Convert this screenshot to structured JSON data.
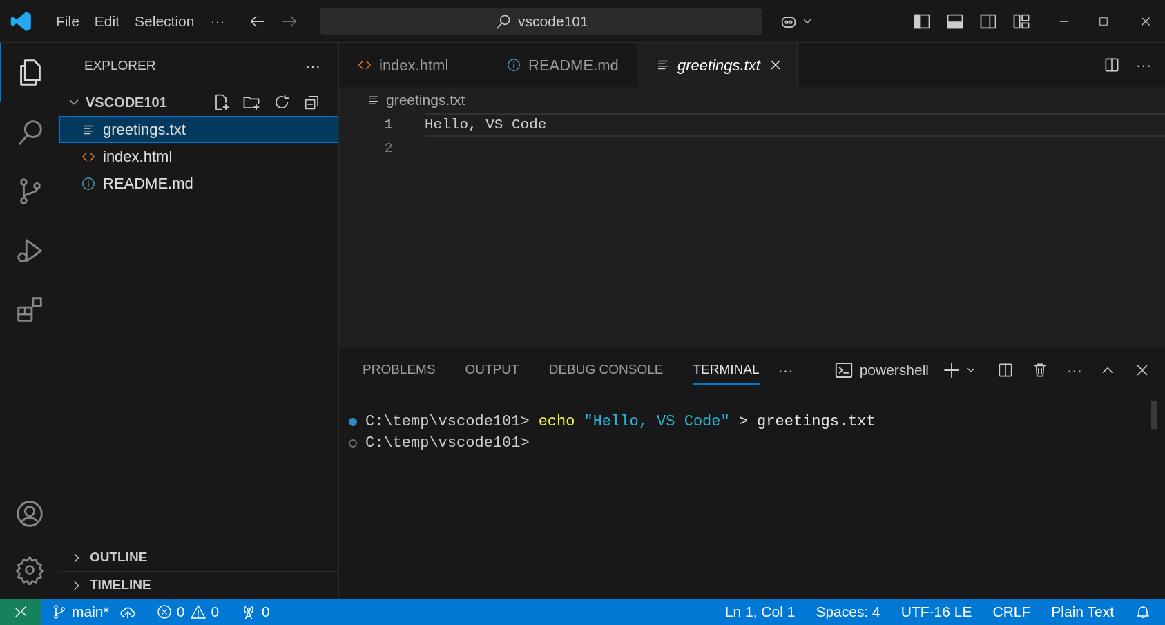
{
  "title_bar": {
    "menus": [
      "File",
      "Edit",
      "Selection"
    ],
    "more": "···",
    "search": "vscode101"
  },
  "activity_bar": {
    "items": [
      {
        "kind": "files",
        "selected": true
      },
      {
        "kind": "search",
        "selected": false
      },
      {
        "kind": "source-control",
        "selected": false
      },
      {
        "kind": "run",
        "selected": false
      },
      {
        "kind": "extensions",
        "selected": false
      }
    ]
  },
  "sidebar": {
    "title": "EXPLORER",
    "more": "···",
    "folder": {
      "name": "VSCODE101",
      "expanded": true
    },
    "files": [
      {
        "name": "greetings.txt",
        "kind": "text",
        "selected": true
      },
      {
        "name": "index.html",
        "kind": "html",
        "selected": false
      },
      {
        "name": "README.md",
        "kind": "info",
        "selected": false
      }
    ],
    "sections": [
      {
        "name": "OUTLINE",
        "expanded": false
      },
      {
        "name": "TIMELINE",
        "expanded": false
      }
    ]
  },
  "tabs": [
    {
      "label": "index.html",
      "kind": "html",
      "selected": false,
      "preview": false
    },
    {
      "label": "README.md",
      "kind": "info",
      "selected": false,
      "preview": false
    },
    {
      "label": "greetings.txt",
      "kind": "text",
      "selected": true,
      "preview": true
    }
  ],
  "editor": {
    "breadcrumb": "greetings.txt",
    "lines": [
      {
        "number": "1",
        "text": "Hello, VS Code",
        "current": true
      },
      {
        "number": "2",
        "current": false
      }
    ]
  },
  "panel": {
    "tabs": [
      {
        "label": "PROBLEMS",
        "selected": false
      },
      {
        "label": "OUTPUT",
        "selected": false
      },
      {
        "label": "DEBUG CONSOLE",
        "selected": false
      },
      {
        "label": "TERMINAL",
        "selected": true
      }
    ],
    "more": "···",
    "shell": "powershell",
    "terminal": [
      {
        "completed": true,
        "segments": [
          {
            "kind": "prompt",
            "text": "C:\\temp\\vscode101>"
          },
          {
            "kind": "command",
            "text": "echo"
          },
          {
            "kind": "string",
            "text": "\"Hello, VS Code\""
          },
          {
            "kind": "plain",
            "text": "> greetings.txt"
          }
        ]
      },
      {
        "completed": false,
        "cursor": true,
        "segments": [
          {
            "kind": "prompt",
            "text": "C:\\temp\\vscode101>"
          }
        ]
      }
    ]
  },
  "status_bar": {
    "branch": "main*",
    "errors": "0",
    "warnings": "0",
    "ports": "0",
    "right": [
      "Ln 1, Col 1",
      "Spaces: 4",
      "UTF-16 LE",
      "CRLF",
      "Plain Text"
    ]
  }
}
